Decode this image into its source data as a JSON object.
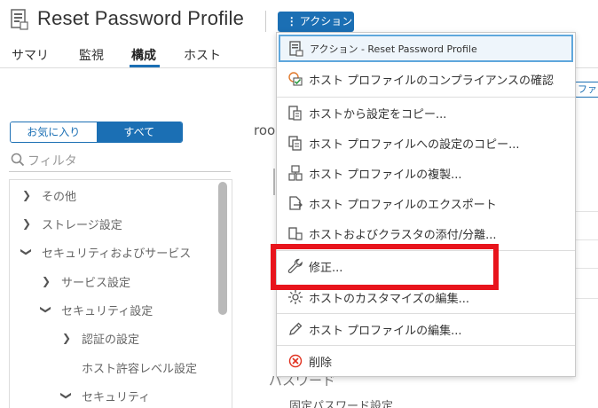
{
  "header": {
    "title": "Reset Password Profile",
    "actions_label": "アクション"
  },
  "tabs": [
    {
      "label": "サマリ",
      "active": false
    },
    {
      "label": "監視",
      "active": false
    },
    {
      "label": "構成",
      "active": true
    },
    {
      "label": "ホスト",
      "active": false
    }
  ],
  "right_edge_button": "ファ",
  "sidebar": {
    "toggle": {
      "favorites": "お気に入り",
      "all": "すべて",
      "selected": "all"
    },
    "filter_placeholder": "フィルタ",
    "tree": [
      {
        "label": "その他",
        "level": 0,
        "expanded": false
      },
      {
        "label": "ストレージ設定",
        "level": 0,
        "expanded": false
      },
      {
        "label": "セキュリティおよびサービス",
        "level": 0,
        "expanded": true
      },
      {
        "label": "サービス設定",
        "level": 1,
        "expanded": false
      },
      {
        "label": "セキュリティ設定",
        "level": 1,
        "expanded": true
      },
      {
        "label": "認証の設定",
        "level": 2,
        "expanded": false
      },
      {
        "label": "ホスト許容レベル設定",
        "level": 2,
        "expanded": null
      },
      {
        "label": "セキュリティ",
        "level": 2,
        "expanded": true
      }
    ]
  },
  "background": {
    "root_text": "roo",
    "section_text": "パスワード",
    "fixed_password": "固定パスワード設定"
  },
  "menu": {
    "items": [
      {
        "label": "アクション - Reset Password Profile",
        "icon": "host-profile-icon"
      },
      {
        "label": "ホスト プロファイルのコンプライアンスの確認",
        "icon": "compliance-check-icon"
      },
      {
        "label": "ホストから設定をコピー...",
        "icon": "copy-from-host-icon"
      },
      {
        "label": "ホスト プロファイルへの設定のコピー...",
        "icon": "copy-to-profile-icon"
      },
      {
        "label": "ホスト プロファイルの複製...",
        "icon": "duplicate-icon"
      },
      {
        "label": "ホスト プロファイルのエクスポート",
        "icon": "export-icon"
      },
      {
        "label": "ホストおよびクラスタの添付/分離...",
        "icon": "attach-detach-icon"
      },
      {
        "label": "修正...",
        "icon": "wrench-icon"
      },
      {
        "label": "ホストのカスタマイズの編集...",
        "icon": "customize-icon"
      },
      {
        "label": "ホスト プロファイルの編集...",
        "icon": "pencil-icon"
      },
      {
        "label": "削除",
        "icon": "delete-icon"
      }
    ]
  },
  "colors": {
    "accent": "#1b6fb4",
    "highlight_border": "#5fa7dc",
    "annotation_red": "#e8141c",
    "delete_red": "#e0301e"
  }
}
